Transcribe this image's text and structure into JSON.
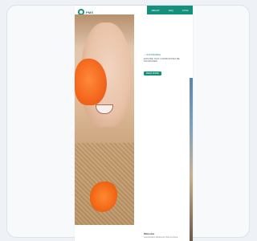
{
  "brand": {
    "logo_text": "PMX"
  },
  "nav": {
    "items": [
      "ABOUT",
      "FAQ",
      "CTAS"
    ]
  },
  "hero": {
    "image_alt": ""
  },
  "content": {
    "eyebrow": "— SUSTAINABLE",
    "headline": "ENSURE THAT COMMUNITIES BE NOURISHED",
    "cta_label": "READ MORE"
  },
  "footer": {
    "title": "Welcome",
    "text": "Assumptions Reference Title text here"
  },
  "colors": {
    "accent": "#14917c",
    "flower": "#f3661c",
    "frame": "#f7f9fb"
  }
}
